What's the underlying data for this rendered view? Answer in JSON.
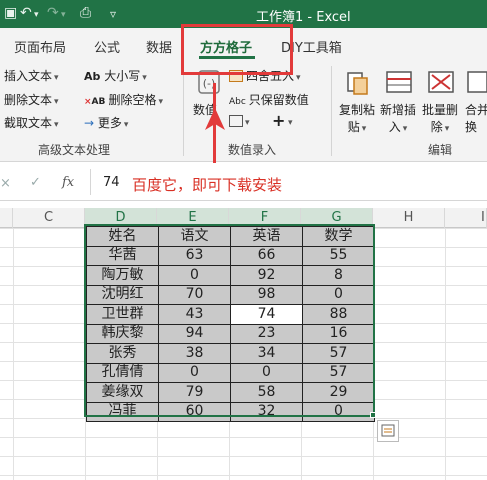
{
  "window": {
    "title": "工作簿1 - Excel"
  },
  "tabs": [
    "页面布局",
    "公式",
    "数据",
    "方方格子",
    "DIY工具箱"
  ],
  "ribbon": {
    "text_group": {
      "items": [
        "插入文本",
        "删除文本",
        "截取文本"
      ],
      "case_label": "大小写",
      "delete_space_label": "删除空格",
      "more_label": "更多",
      "group_label": "高级文本处理"
    },
    "number_group": {
      "numeric_label": "数值",
      "round_label": "四舍五入",
      "keep_value_label": "只保留数值",
      "group_label": "数值录入"
    },
    "edit_group": {
      "copy_paste": [
        "复制粘",
        "贴"
      ],
      "insert_new": [
        "新增插",
        "入"
      ],
      "batch_delete": [
        "批量删",
        "除"
      ],
      "merge": [
        "合并",
        "换"
      ],
      "group_label": "编辑"
    }
  },
  "formula_bar": {
    "value": "74",
    "annotation": "百度它，即可下载安装"
  },
  "columns": [
    "C",
    "D",
    "E",
    "F",
    "G",
    "H",
    "I"
  ],
  "table": {
    "headers": [
      "姓名",
      "语文",
      "英语",
      "数学"
    ],
    "rows": [
      [
        "华茜",
        "63",
        "66",
        "55"
      ],
      [
        "陶万敏",
        "0",
        "92",
        "8"
      ],
      [
        "沈明红",
        "70",
        "98",
        "0"
      ],
      [
        "卫世群",
        "43",
        "74",
        "88"
      ],
      [
        "韩庆黎",
        "94",
        "23",
        "16"
      ],
      [
        "张秀",
        "38",
        "34",
        "57"
      ],
      [
        "孔倩倩",
        "0",
        "0",
        "57"
      ],
      [
        "姜缘双",
        "79",
        "58",
        "29"
      ],
      [
        "冯菲",
        "60",
        "32",
        "0"
      ]
    ]
  },
  "colors": {
    "excel_green": "#217346",
    "highlight_red": "#e23a3a",
    "cell_fill": "#c9c9c9"
  }
}
